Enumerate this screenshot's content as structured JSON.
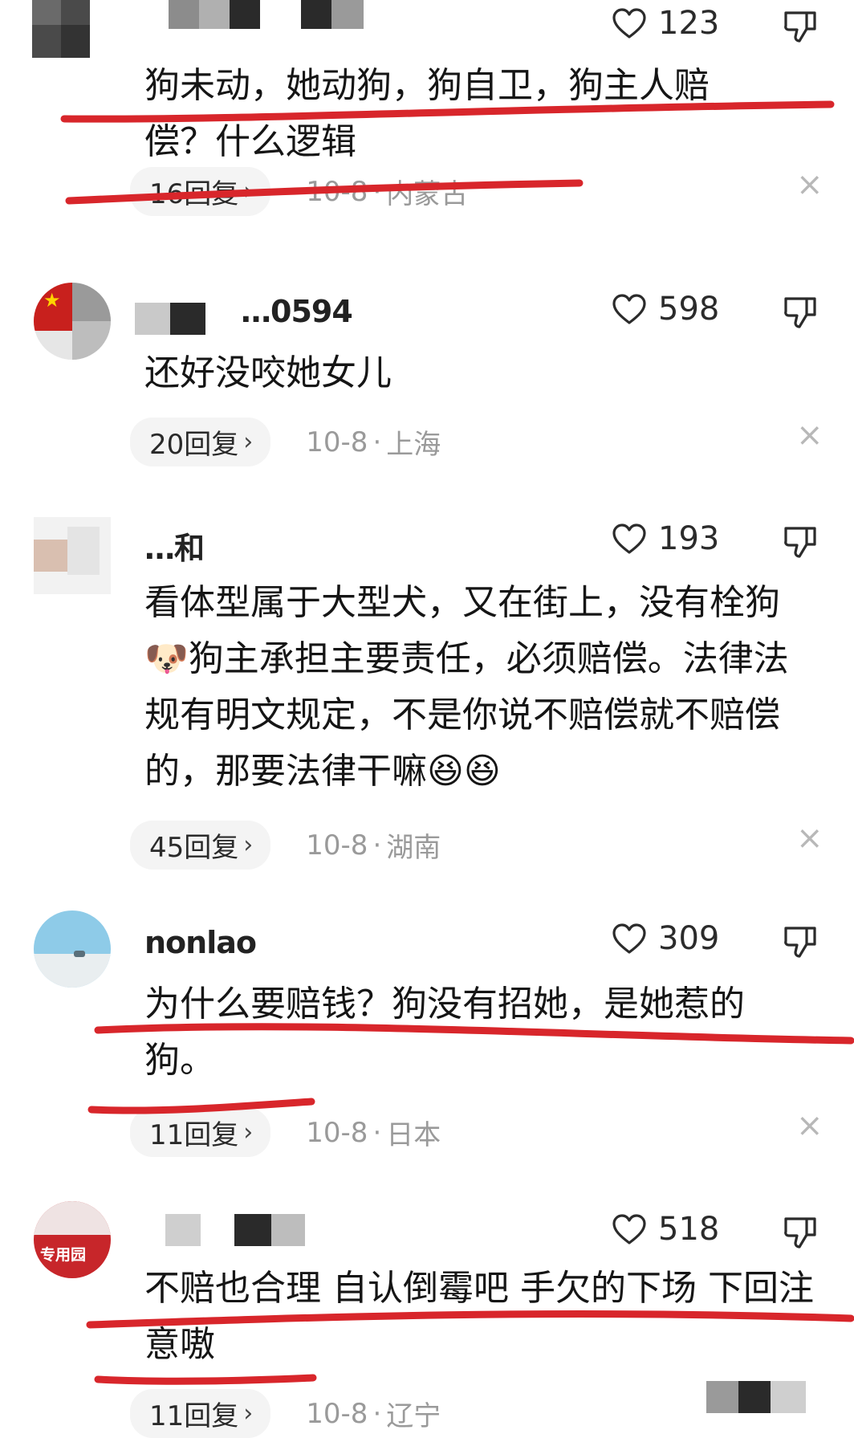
{
  "comments": [
    {
      "username": "",
      "likes": "123",
      "text": "狗未动，她动狗，狗自卫，狗主人赔偿？什么逻辑",
      "replies": "16回复",
      "chevron": "›",
      "date": "10-8",
      "location": "内蒙古",
      "close": "×"
    },
    {
      "username": "…0594",
      "likes": "598",
      "text": "还好没咬她女儿",
      "replies": "20回复",
      "chevron": "›",
      "date": "10-8",
      "location": "上海",
      "close": "×"
    },
    {
      "username": "…和",
      "likes": "193",
      "text": "看体型属于大型犬，又在街上，没有栓狗🐶狗主承担主要责任，必须赔偿。法律法规有明文规定，不是你说不赔偿就不赔偿的，那要法律干嘛😆😆",
      "replies": "45回复",
      "chevron": "›",
      "date": "10-8",
      "location": "湖南",
      "close": "×"
    },
    {
      "username": "nonlao",
      "likes": "309",
      "text": "为什么要赔钱？狗没有招她，是她惹的狗。",
      "replies": "11回复",
      "chevron": "›",
      "date": "10-8",
      "location": "日本",
      "close": "×"
    },
    {
      "username": "",
      "likes": "518",
      "avatar_text": "专用园",
      "text": "不赔也合理 自认倒霉吧 手欠的下场 下回注意嗷",
      "replies": "11回复",
      "chevron": "›",
      "date": "10-8",
      "location": "辽宁",
      "close": "×"
    }
  ],
  "separator": "·",
  "icons": {
    "like": "heart-outline-icon",
    "dislike": "thumbs-down-icon"
  },
  "colors": {
    "annotation_underline": "#d8262b",
    "meta_text": "#9a9a9a",
    "body_text": "#151515"
  }
}
